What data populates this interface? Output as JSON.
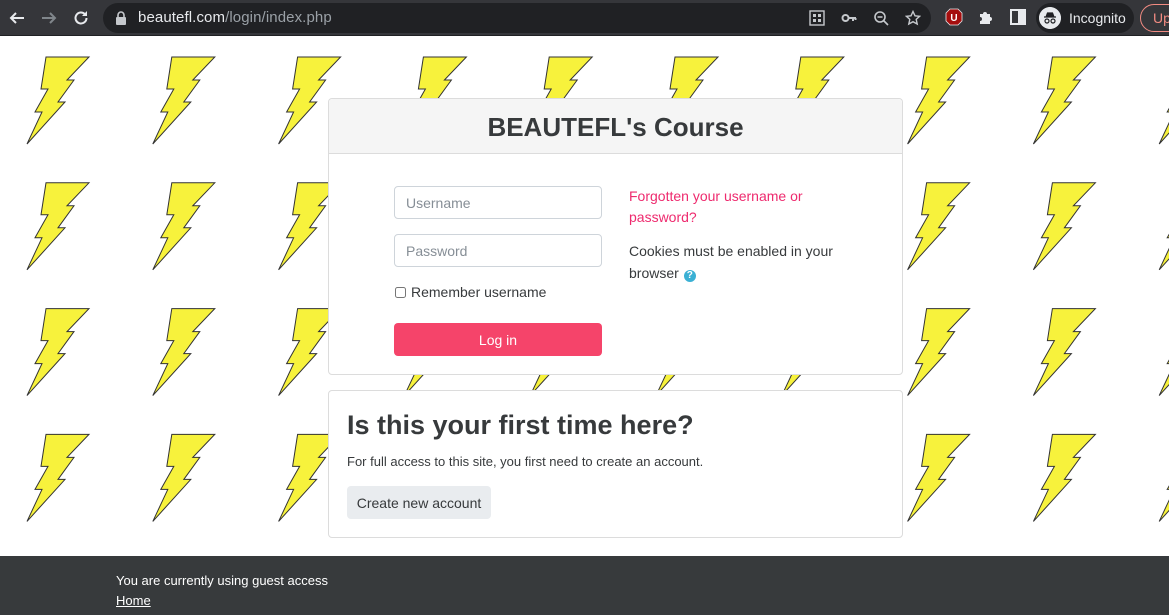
{
  "browser": {
    "url_host": "beautefl.com",
    "url_path": "/login/index.php",
    "profile_label": "Incognito",
    "update_label": "Up",
    "icons": [
      "back-icon",
      "forward-icon",
      "reload-icon",
      "lock-icon",
      "qr-code-icon",
      "key-icon",
      "zoom-icon",
      "star-icon",
      "ublock-icon",
      "extensions-icon",
      "side-panel-icon",
      "incognito-icon"
    ]
  },
  "login": {
    "title": "BEAUTEFL's Course",
    "username_placeholder": "Username",
    "username_value": "",
    "password_placeholder": "Password",
    "password_value": "",
    "remember_label": "Remember username",
    "remember_checked": false,
    "login_button": "Log in",
    "forgot_link": "Forgotten your username or password?",
    "cookies_text": "Cookies must be enabled in your browser",
    "help_icon_glyph": "?"
  },
  "signup": {
    "title": "Is this your first time here?",
    "text": "For full access to this site, you first need to create an account.",
    "create_button": "Create new account"
  },
  "footer": {
    "guest_text": "You are currently using guest access",
    "home_link": "Home"
  },
  "colors": {
    "accent": "#f5446a",
    "link": "#ee2a6e",
    "bolt_fill": "#f7f23c",
    "footer_bg": "#373a3c"
  }
}
